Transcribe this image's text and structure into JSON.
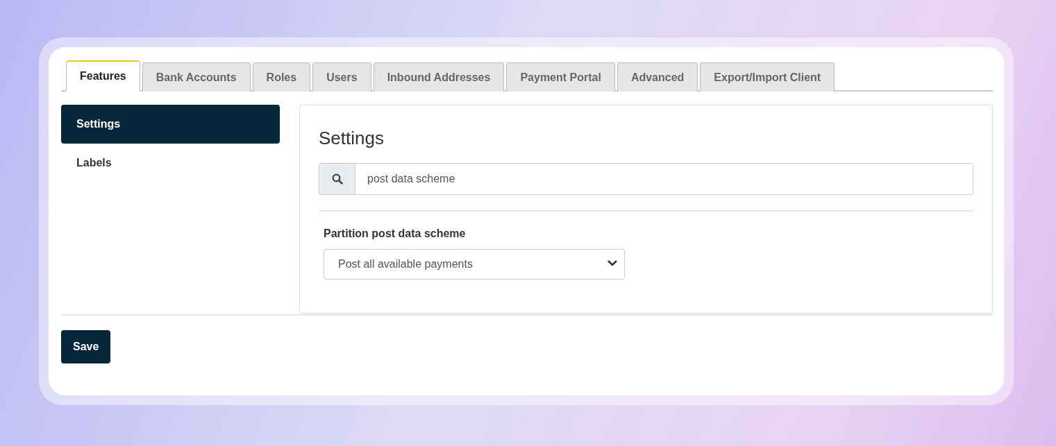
{
  "tabs": [
    {
      "label": "Features",
      "selected": true
    },
    {
      "label": "Bank Accounts",
      "selected": false
    },
    {
      "label": "Roles",
      "selected": false
    },
    {
      "label": "Users",
      "selected": false
    },
    {
      "label": "Inbound Addresses",
      "selected": false
    },
    {
      "label": "Payment Portal",
      "selected": false
    },
    {
      "label": "Advanced",
      "selected": false
    },
    {
      "label": "Export/Import Client",
      "selected": false
    }
  ],
  "sidebar": {
    "items": [
      {
        "label": "Settings",
        "selected": true
      },
      {
        "label": "Labels",
        "selected": false
      }
    ]
  },
  "panel": {
    "title": "Settings",
    "search": {
      "value": "post data scheme"
    },
    "fields": [
      {
        "label": "Partition post data scheme",
        "value": "Post all available payments"
      }
    ]
  },
  "save_button": "Save"
}
